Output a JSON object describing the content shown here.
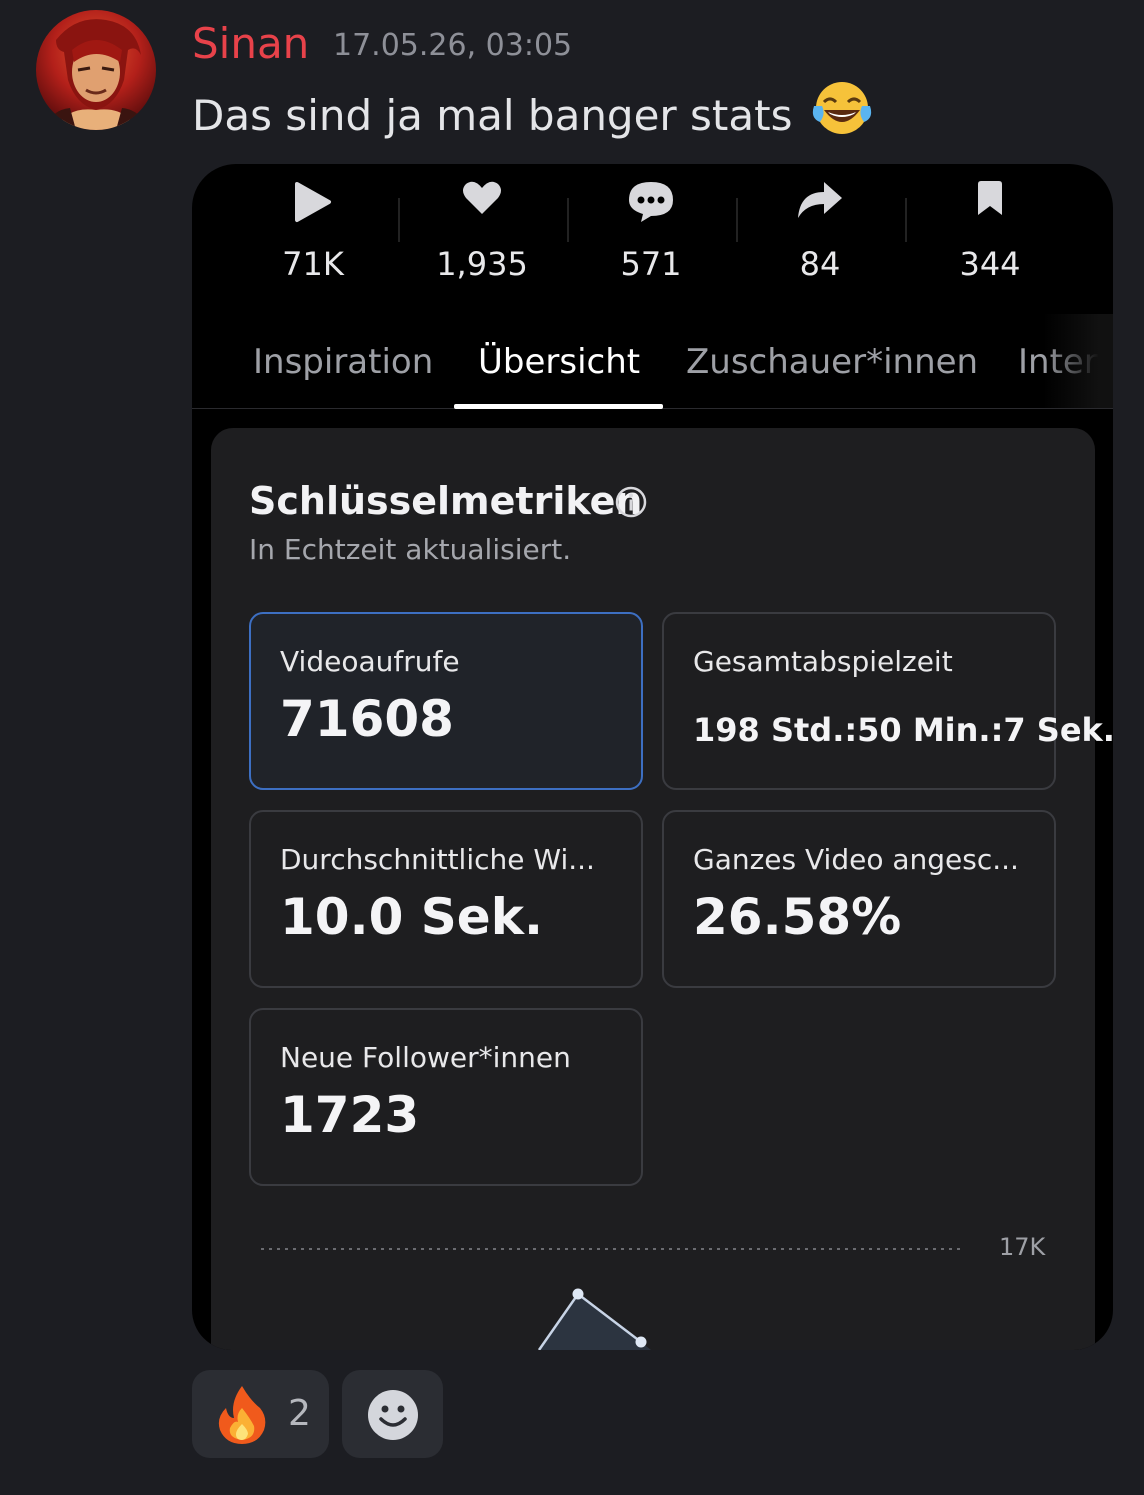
{
  "message": {
    "author": "Sinan",
    "timestamp": "17.05.26, 03:05",
    "text": "Das sind ja mal banger stats",
    "emoji": "face-with-tears-of-joy-icon"
  },
  "video_stats": [
    {
      "icon": "play-icon",
      "value": "71K"
    },
    {
      "icon": "heart-icon",
      "value": "1,935"
    },
    {
      "icon": "comment-icon",
      "value": "571"
    },
    {
      "icon": "share-icon",
      "value": "84"
    },
    {
      "icon": "bookmark-icon",
      "value": "344"
    }
  ],
  "tabs": [
    {
      "label": "Inspiration",
      "active": false
    },
    {
      "label": "Übersicht",
      "active": true
    },
    {
      "label": "Zuschauer*innen",
      "active": false
    },
    {
      "label": "Intera",
      "active": false
    }
  ],
  "key_metrics": {
    "title": "Schlüsselmetriken",
    "subtitle": "In Echtzeit aktualisiert.",
    "items": [
      {
        "label": "Videoaufrufe",
        "value": "71608",
        "selected": true
      },
      {
        "label": "Gesamtabspielzeit",
        "value": "198 Std.:50 Min.:7 Sek.",
        "selected": false
      },
      {
        "label": "Durchschnittliche Wi...",
        "value": "10.0 Sek.",
        "selected": false
      },
      {
        "label": "Ganzes Video angesc...",
        "value": "26.58%",
        "selected": false
      },
      {
        "label": "Neue Follower*innen",
        "value": "1723",
        "selected": false
      }
    ]
  },
  "chart": {
    "gridline_label": "17K"
  },
  "reactions": [
    {
      "emoji": "fire-icon",
      "count": "2"
    }
  ],
  "colors": {
    "background": "#1c1d22",
    "username": "#e8424a",
    "selected_border": "#3d6fc2"
  }
}
